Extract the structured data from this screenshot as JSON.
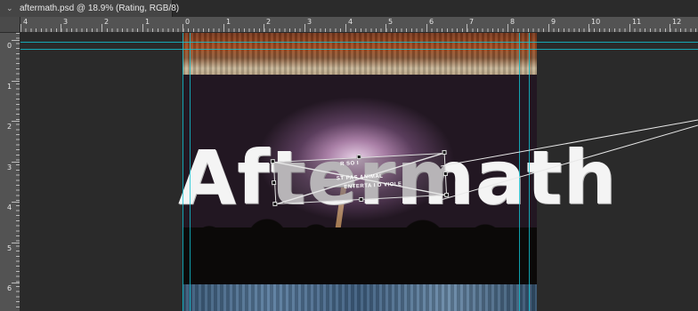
{
  "tab": {
    "title": "aftermath.psd @ 18.9% (Rating, RGB/8)"
  },
  "rulers": {
    "horizontal_labels": [
      "4",
      "3",
      "2",
      "1",
      "0",
      "1",
      "2",
      "3",
      "4",
      "5",
      "6",
      "7",
      "8",
      "9",
      "10",
      "11",
      "12"
    ],
    "vertical_labels": [
      "0",
      "1",
      "2",
      "3",
      "4",
      "5",
      "6"
    ]
  },
  "canvas": {
    "headline": "Aftermath",
    "pasted_line1": "R SO I",
    "pasted_line2": "ST PAS ANIMAL",
    "pasted_line3": "ENTERTA I D VIOLE"
  },
  "colors": {
    "guide": "#12c5d6",
    "ruler": "#535353",
    "workspace": "#2a2a2a"
  }
}
